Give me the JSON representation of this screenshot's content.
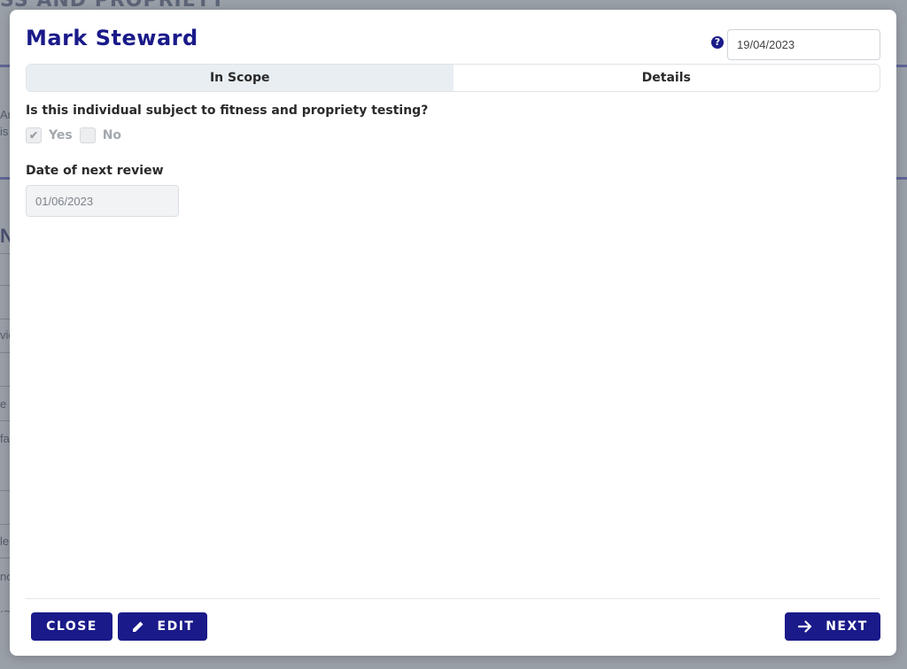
{
  "background": {
    "heading": "SS AND PROPRIETY",
    "fragments": [
      "Ar",
      "is",
      "N",
      "vic",
      "e",
      "fa",
      "le",
      "no",
      "·~"
    ]
  },
  "modal": {
    "title": "Mark Steward",
    "date_value": "19/04/2023",
    "help_icon": "question-circle-icon"
  },
  "tabs": [
    {
      "label": "In Scope",
      "active": true
    },
    {
      "label": "Details",
      "active": false
    }
  ],
  "form": {
    "question": "Is this individual subject to fitness and propriety testing?",
    "yes_label": "Yes",
    "yes_checked": true,
    "no_label": "No",
    "no_checked": false,
    "review_label": "Date of next review",
    "review_value": "01/06/2023"
  },
  "footer": {
    "close_label": "CLOSE",
    "edit_label": "EDIT",
    "next_label": "NEXT",
    "edit_icon": "pencil-icon",
    "next_icon": "arrow-right-icon"
  },
  "colors": {
    "brand": "#1a1a8a",
    "tab_active_bg": "#e8eef2"
  }
}
